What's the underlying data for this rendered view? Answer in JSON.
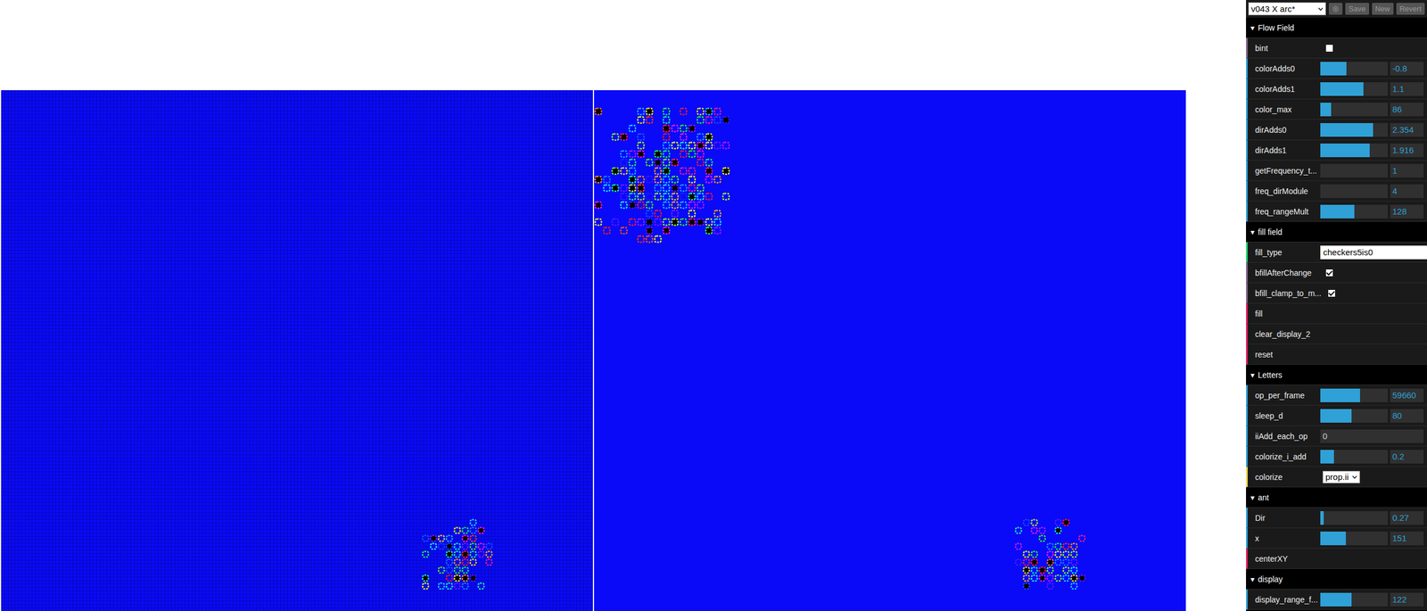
{
  "preset": {
    "value": "v043 X arc*"
  },
  "toolbar_buttons": [
    {
      "label": "Save"
    },
    {
      "label": "New"
    },
    {
      "label": "Revert"
    }
  ],
  "folders": [
    {
      "title": "Flow Field",
      "arrow": "▾",
      "expanded": true,
      "controls": [
        {
          "kind": "checkbox",
          "label": "bint",
          "checked": false
        },
        {
          "kind": "slider",
          "label": "colorAdds0",
          "level": 0.39,
          "value": "-0.8"
        },
        {
          "kind": "slider",
          "label": "colorAdds1",
          "level": 0.64,
          "value": "1.1"
        },
        {
          "kind": "slider",
          "label": "color_max",
          "level": 0.16,
          "value": "86"
        },
        {
          "kind": "slider",
          "label": "dirAdds0",
          "level": 0.78,
          "value": "2.354"
        },
        {
          "kind": "slider",
          "label": "dirAdds1",
          "level": 0.73,
          "value": "1.916"
        },
        {
          "kind": "slider",
          "label": "getFrequency_t...",
          "level": 0,
          "value": "1"
        },
        {
          "kind": "slider",
          "label": "freq_dirModule",
          "level": 0,
          "value": "4"
        },
        {
          "kind": "slider",
          "label": "freq_rangeMult",
          "level": 0.5,
          "value": "128"
        }
      ]
    },
    {
      "title": "fill field",
      "arrow": "▾",
      "expanded": true,
      "controls": [
        {
          "kind": "text",
          "label": "fill_type",
          "value": "checkers5is0"
        },
        {
          "kind": "checkbox",
          "label": "bfillAfterChange",
          "checked": true
        },
        {
          "kind": "checkbox",
          "label": "bfill_clamp_to_m...",
          "checked": true
        },
        {
          "kind": "button",
          "label": "fill"
        },
        {
          "kind": "button",
          "label": "clear_display_2"
        },
        {
          "kind": "button",
          "label": "reset"
        }
      ]
    },
    {
      "title": "Letters",
      "arrow": "▾",
      "expanded": true,
      "controls": [
        {
          "kind": "slider",
          "label": "op_per_frame",
          "level": 0.59,
          "value": "59660"
        },
        {
          "kind": "slider",
          "label": "sleep_d",
          "level": 0.46,
          "value": "80"
        },
        {
          "kind": "number",
          "label": "iiAdd_each_op",
          "value": "0"
        },
        {
          "kind": "slider",
          "label": "colorize_i_add",
          "level": 0.2,
          "value": "0.2"
        },
        {
          "kind": "select",
          "label": "colorize",
          "value": "prop.ii"
        }
      ]
    },
    {
      "title": "ant",
      "arrow": "▾",
      "expanded": true,
      "controls": [
        {
          "kind": "slider",
          "label": "Dir",
          "level": 0.05,
          "value": "0.27"
        },
        {
          "kind": "slider",
          "label": "x",
          "level": 0.38,
          "value": "151"
        },
        {
          "kind": "button",
          "label": "centerXY"
        }
      ]
    },
    {
      "title": "display",
      "arrow": "▾",
      "expanded": true,
      "controls": [
        {
          "kind": "slider",
          "label": "display_range_f...",
          "level": 0.46,
          "value": "122"
        }
      ]
    }
  ]
}
